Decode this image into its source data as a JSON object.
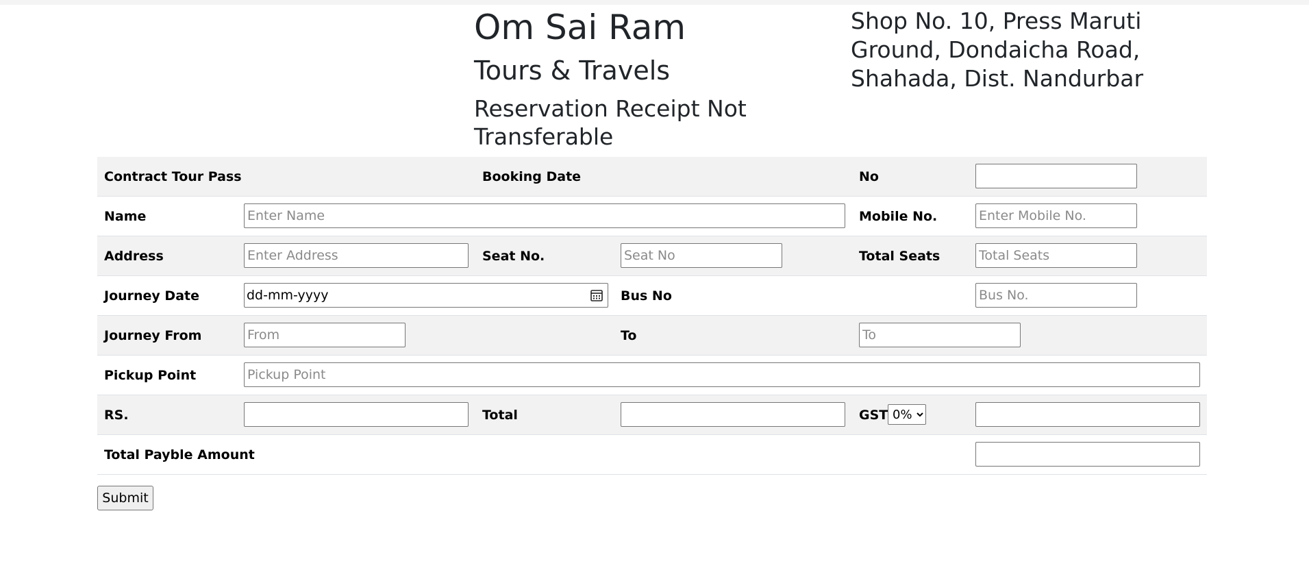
{
  "header": {
    "title": "Om Sai Ram",
    "subtitle": "Tours & Travels",
    "receipt_note": "Reservation Receipt Not Transferable",
    "address": "Shop No. 10, Press Maruti Ground, Dondaicha Road, Shahada, Dist. Nandurbar"
  },
  "form": {
    "contract_tour_pass": "Contract Tour Pass",
    "booking_date": "Booking Date",
    "no": "No",
    "name": {
      "label": "Name",
      "placeholder": "Enter Name"
    },
    "mobile": {
      "label": "Mobile No.",
      "placeholder": "Enter Mobile No."
    },
    "address": {
      "label": "Address",
      "placeholder": "Enter Address"
    },
    "seat_no": {
      "label": "Seat No.",
      "placeholder": "Seat No"
    },
    "total_seats": {
      "label": "Total Seats",
      "placeholder": "Total Seats"
    },
    "journey_date": {
      "label": "Journey Date",
      "value": "dd-mm-yyyy"
    },
    "bus_no": {
      "label": "Bus No",
      "placeholder": "Bus No."
    },
    "journey_from": {
      "label": "Journey From",
      "placeholder": "From"
    },
    "to": {
      "label": "To",
      "placeholder": "To"
    },
    "pickup": {
      "label": "Pickup Point",
      "placeholder": "Pickup Point"
    },
    "rs": "RS.",
    "total": "Total",
    "gst": {
      "label": "GST",
      "selected": "0%"
    },
    "total_payable": "Total Payble Amount",
    "submit": "Submit"
  },
  "icons": {
    "journey_date": "calendar-icon"
  }
}
